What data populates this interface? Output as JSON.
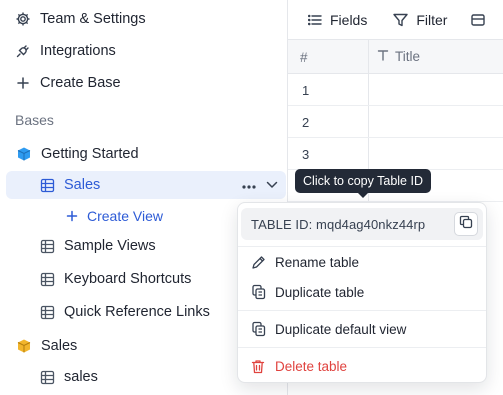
{
  "sidebar": {
    "items": [
      {
        "label": "Team & Settings",
        "icon": "gear-icon"
      },
      {
        "label": "Integrations",
        "icon": "plug-icon"
      },
      {
        "label": "Create Base",
        "icon": "plus-icon"
      }
    ],
    "section_label": "Bases",
    "bases": [
      {
        "label": "Getting Started",
        "icon": "base-icon-blue",
        "tables": [
          {
            "label": "Sales",
            "active": true
          },
          {
            "label": "+ Create View",
            "is_action": true
          },
          {
            "label": "Sample Views"
          },
          {
            "label": "Keyboard Shortcuts"
          },
          {
            "label": "Quick Reference Links"
          }
        ]
      },
      {
        "label": "Sales",
        "icon": "base-icon-yellow",
        "tables": [
          {
            "label": "sales"
          }
        ]
      }
    ],
    "create_view_label": "Create View"
  },
  "toolbar": {
    "fields_label": "Fields",
    "filter_label": "Filter"
  },
  "grid": {
    "headers": {
      "row_number": "#",
      "title": "Title"
    },
    "rows": [
      "1",
      "2",
      "3"
    ]
  },
  "tooltip": {
    "text": "Click to copy Table ID"
  },
  "context_menu": {
    "table_id_label": "TABLE ID: mqd4ag40nkz44rp",
    "items": [
      {
        "label": "Rename table",
        "icon": "pencil-icon"
      },
      {
        "label": "Duplicate table",
        "icon": "duplicate-icon"
      },
      {
        "label": "Duplicate default view",
        "icon": "duplicate-icon"
      },
      {
        "label": "Delete table",
        "icon": "trash-icon",
        "danger": true
      }
    ]
  },
  "colors": {
    "accent": "#3366ff",
    "active_row_bg": "#eaf0fc",
    "danger": "#e0433f",
    "tooltip_bg": "#232a37",
    "base_blue": "#2f9bf0",
    "base_yellow": "#f2b52c"
  }
}
